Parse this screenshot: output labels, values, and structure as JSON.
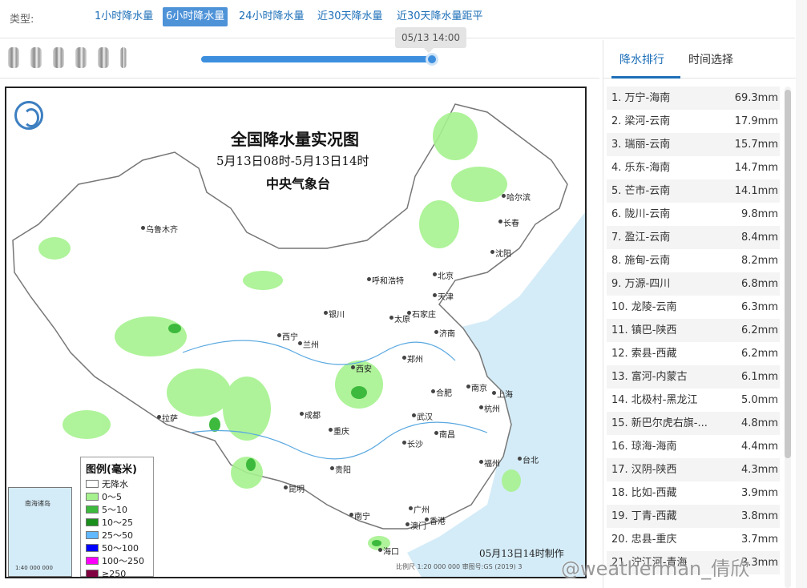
{
  "type_bar": {
    "label": "类型:",
    "tabs": [
      {
        "label": "1小时降水量",
        "active": false
      },
      {
        "label": "6小时降水量",
        "active": true
      },
      {
        "label": "24小时降水量",
        "active": false
      },
      {
        "label": "近30天降水量",
        "active": false
      },
      {
        "label": "近30天降水量距平",
        "active": false
      }
    ]
  },
  "slider": {
    "tooltip": "05/13 14:00",
    "progress": 1.0
  },
  "map": {
    "title": "全国降水量实况图",
    "subtitle": "5月13日08时-5月13日14时",
    "agency": "中央气象台",
    "made_note": "05月13日14时制作",
    "scale_note": "比例尺 1:20 000 000    审图号:GS (2019) 3",
    "legend": {
      "title": "图例(毫米)",
      "items": [
        {
          "label": "无降水",
          "color": "#ffffff"
        },
        {
          "label": "0～5",
          "color": "#a6f28f"
        },
        {
          "label": "5～10",
          "color": "#3dba3d"
        },
        {
          "label": "10～25",
          "color": "#1b8f1b"
        },
        {
          "label": "25～50",
          "color": "#61b8ff"
        },
        {
          "label": "50～100",
          "color": "#0000ff"
        },
        {
          "label": "100～250",
          "color": "#fa00fa"
        },
        {
          "label": "≥250",
          "color": "#800040"
        }
      ]
    },
    "inset": {
      "sea_label": "南海诸岛",
      "scale": "1:40 000 000"
    },
    "cities": [
      "乌鲁木齐",
      "哈尔滨",
      "长春",
      "沈阳",
      "呼和浩特",
      "北京",
      "天津",
      "银川",
      "石家庄",
      "太原",
      "济南",
      "西宁",
      "兰州",
      "郑州",
      "西安",
      "合肥",
      "南京",
      "上海",
      "拉萨",
      "成都",
      "武汉",
      "杭州",
      "重庆",
      "南昌",
      "长沙",
      "福州",
      "台北",
      "贵阳",
      "昆明",
      "南宁",
      "广州",
      "香港",
      "澳门",
      "海口"
    ]
  },
  "right_panel": {
    "tabs": [
      {
        "label": "降水排行",
        "active": true
      },
      {
        "label": "时间选择",
        "active": false
      }
    ],
    "ranking": [
      {
        "name": "1. 万宁-海南",
        "value": "69.3mm"
      },
      {
        "name": "2. 梁河-云南",
        "value": "17.9mm"
      },
      {
        "name": "3. 瑞丽-云南",
        "value": "15.7mm"
      },
      {
        "name": "4. 乐东-海南",
        "value": "14.7mm"
      },
      {
        "name": "5. 芒市-云南",
        "value": "14.1mm"
      },
      {
        "name": "6. 陇川-云南",
        "value": "9.8mm"
      },
      {
        "name": "7. 盈江-云南",
        "value": "8.4mm"
      },
      {
        "name": "8. 施甸-云南",
        "value": "8.2mm"
      },
      {
        "name": "9. 万源-四川",
        "value": "6.8mm"
      },
      {
        "name": "10. 龙陵-云南",
        "value": "6.3mm"
      },
      {
        "name": "11. 镇巴-陕西",
        "value": "6.2mm"
      },
      {
        "name": "12. 索县-西藏",
        "value": "6.2mm"
      },
      {
        "name": "13. 富河-内蒙古",
        "value": "6.1mm"
      },
      {
        "name": "14. 北极村-黑龙江",
        "value": "5.0mm"
      },
      {
        "name": "15. 新巴尔虎右旗-...",
        "value": "4.8mm"
      },
      {
        "name": "16. 琼海-海南",
        "value": "4.4mm"
      },
      {
        "name": "17. 汉阴-陕西",
        "value": "4.3mm"
      },
      {
        "name": "18. 比如-西藏",
        "value": "3.9mm"
      },
      {
        "name": "19. 丁青-西藏",
        "value": "3.8mm"
      },
      {
        "name": "20. 忠县-重庆",
        "value": "3.7mm"
      },
      {
        "name": "21. 泞江河-青海",
        "value": "3.3mm"
      }
    ]
  },
  "watermark": "@weatherman_倩欣"
}
